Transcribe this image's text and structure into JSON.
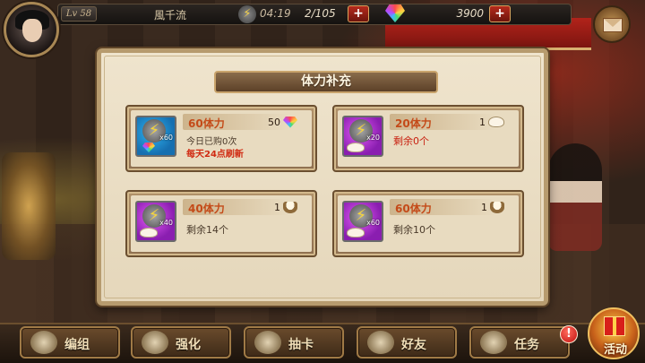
{
  "header": {
    "level": "Lv 58",
    "player_name": "風千流",
    "stamina_timer": "04:19",
    "stamina": "2/105",
    "stamina_plus": "+",
    "gems": "3900",
    "gems_plus": "+"
  },
  "dialog": {
    "title": "体力补充",
    "cards": [
      {
        "name": "60体力",
        "price": "50",
        "price_currency": "gem",
        "icon_bg": "blue",
        "multiplier": "x60",
        "line1": "今日已购0次",
        "line2": "每天24点刷新"
      },
      {
        "name": "20体力",
        "price": "1",
        "price_currency": "bun",
        "icon_bg": "purple",
        "multiplier": "x20",
        "remaining": "剩余0个"
      },
      {
        "name": "40体力",
        "price": "1",
        "price_currency": "bowl",
        "icon_bg": "purple",
        "multiplier": "x40",
        "remaining": "剩余14个"
      },
      {
        "name": "60体力",
        "price": "1",
        "price_currency": "bun-plate",
        "icon_bg": "purple",
        "multiplier": "x60",
        "remaining": "剩余10个"
      }
    ]
  },
  "nav": {
    "items": [
      {
        "label": "编组",
        "icon": "team-icon"
      },
      {
        "label": "强化",
        "icon": "enhance-icon"
      },
      {
        "label": "抽卡",
        "icon": "draw-card-icon"
      },
      {
        "label": "好友",
        "icon": "friends-icon"
      },
      {
        "label": "任务",
        "icon": "quest-icon"
      }
    ],
    "alert": "!",
    "activity_label": "活动"
  },
  "colors": {
    "panel_bg": "#efe4cd",
    "accent_red": "#d02a12",
    "card_name": "#c44a18"
  }
}
